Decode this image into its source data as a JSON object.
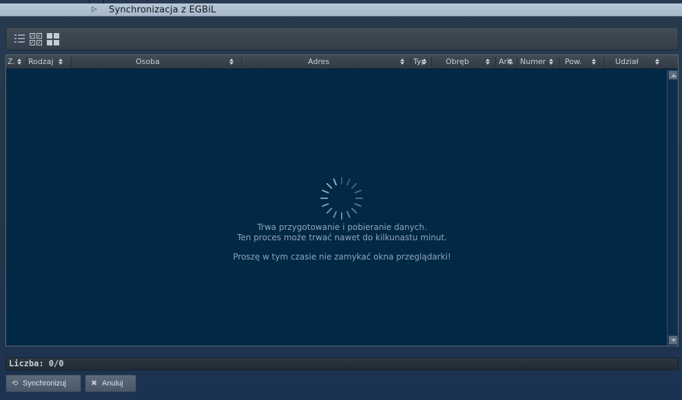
{
  "window": {
    "title": "Synchronizacja z EGBiL"
  },
  "toolbar": {
    "icons": [
      "list-icon",
      "check-all-icon",
      "grid-view-icon"
    ]
  },
  "table": {
    "columns": [
      "Z.",
      "Rodzaj",
      "Osoba",
      "Adres",
      "Typ",
      "Obręb",
      "Ark.",
      "Numer",
      "Pow.",
      "Udział"
    ]
  },
  "loading": {
    "line1": "Trwa przygotowanie i pobieranie danych.",
    "line2": "Ten proces może trwać nawet do kilkunastu minut.",
    "line3": "Proszę w tym czasie nie zamykać okna przeglądarki!"
  },
  "footer": {
    "count_label": "Liczba: 0/0"
  },
  "buttons": {
    "sync_label": "Synchronizuj",
    "cancel_label": "Anuluj"
  }
}
